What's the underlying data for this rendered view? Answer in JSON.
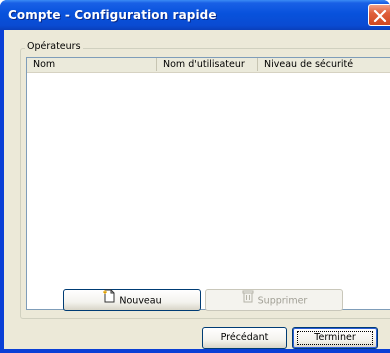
{
  "window": {
    "title": "Compte - Configuration rapide"
  },
  "group": {
    "label": "Opérateurs"
  },
  "list": {
    "columns": [
      "Nom",
      "Nom d'utilisateur",
      "Niveau de sécurité"
    ],
    "rows": []
  },
  "buttons": {
    "new_label": "Nouveau",
    "delete_label": "Supprimer",
    "previous_label": "Précédant",
    "finish_label": "Terminer"
  }
}
